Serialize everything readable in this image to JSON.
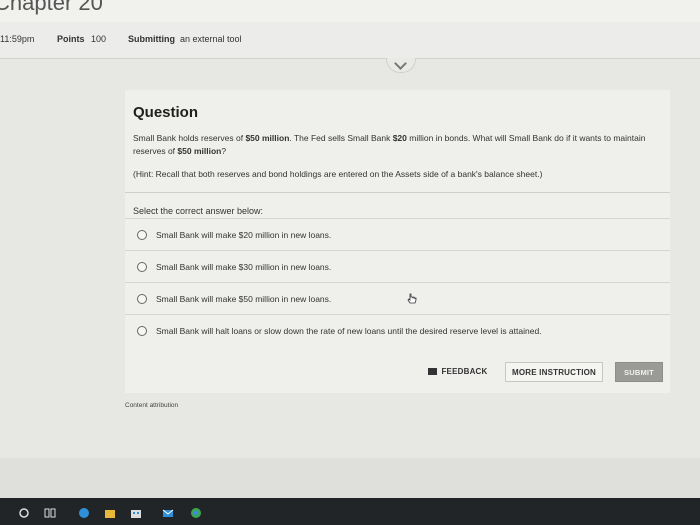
{
  "header": {
    "chapter_title": "Chapter 20"
  },
  "info_bar": {
    "time": "11:59pm",
    "points_label": "Points",
    "points_value": "100",
    "submitting_label": "Submitting",
    "submitting_value": "an external tool"
  },
  "question": {
    "title": "Question",
    "text_part1": "Small Bank holds reserves of ",
    "reserve_amount": "$50 million",
    "text_part2": ". The Fed sells Small Bank ",
    "bond_amount": "$20",
    "text_part3": " million in bonds. What will Small Bank do if it wants to maintain reserves of ",
    "target_amount": "$50 million",
    "text_part4": "?",
    "hint": "(Hint: Recall that both reserves and bond holdings are entered on the Assets side of a bank's balance sheet.)",
    "select_label": "Select the correct answer below:"
  },
  "options": [
    {
      "label": "Small Bank will make $20 million in new loans."
    },
    {
      "label": "Small Bank will make $30 million in new loans."
    },
    {
      "label": "Small Bank will make $50 million in new loans."
    },
    {
      "label": "Small Bank will halt loans or slow down the rate of new loans until the desired reserve level is attained."
    }
  ],
  "buttons": {
    "feedback": "FEEDBACK",
    "more_instruction": "MORE INSTRUCTION",
    "submit": "SUBMIT"
  },
  "attribution": "Content attribution",
  "icons": {
    "radio": "radio-unchecked-icon",
    "feedback": "feedback-icon",
    "cursor": "hand-cursor-icon"
  },
  "colors": {
    "page_background": "#e7e8e4",
    "card_background": "#efefec",
    "submit_button": "#9a9a96",
    "taskbar": "#222528"
  }
}
